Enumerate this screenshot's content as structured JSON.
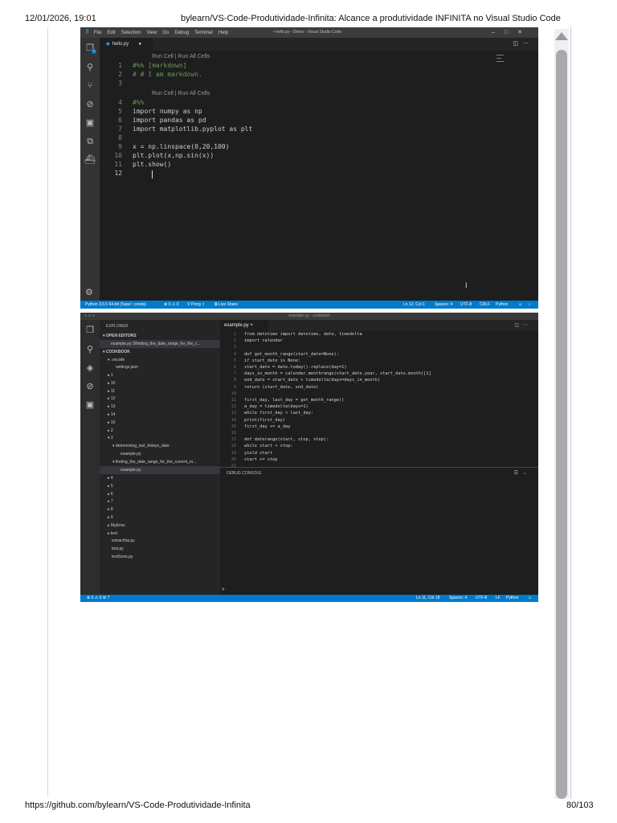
{
  "page": {
    "timestamp": "12/01/2026, 19:01",
    "title": "bylearn/VS-Code-Produtividade-Infinita: Alcance a produtividade INFINITA no Visual Studio Code",
    "footer_url": "https://github.com/bylearn/VS-Code-Produtividade-Infinita",
    "page_number": "80/103"
  },
  "window1": {
    "menu": [
      "File",
      "Edit",
      "Selection",
      "View",
      "Go",
      "Debug",
      "Terminal",
      "Help"
    ],
    "title": "• hello.py - Demo - Visual Studio Code",
    "tab_label": "hello.py",
    "codelens": [
      "Run Cell | Run All Cells",
      "Run Cell | Run All Cells"
    ],
    "lines": [
      {
        "n": "1",
        "code": "#%% [markdown]"
      },
      {
        "n": "2",
        "code": "# # I am markdown."
      },
      {
        "n": "3",
        "code": ""
      },
      {
        "n": "4",
        "code": "#%%"
      },
      {
        "n": "5",
        "code": "import numpy as np"
      },
      {
        "n": "6",
        "code": "import pandas as pd"
      },
      {
        "n": "7",
        "code": "import matplotlib.pyplot as plt"
      },
      {
        "n": "8",
        "code": ""
      },
      {
        "n": "9",
        "code": "x = np.linspace(0,20,100)"
      },
      {
        "n": "10",
        "code": "plt.plot(x,np.sin(x))"
      },
      {
        "n": "11",
        "code": "plt.show()"
      },
      {
        "n": "12",
        "code": ""
      }
    ],
    "status": {
      "python": "Python 3.6.5 64-bit ('base': conda)",
      "problems": "⊗ 0 ⚠ 0",
      "pong": "⚲ Pong ⇧",
      "liveshare": "⧉ Live Share",
      "position": "Ln 12, Col 1",
      "spaces": "Spaces: 4",
      "encoding": "UTF-8",
      "eol": "CRLF",
      "language": "Python"
    }
  },
  "window2": {
    "title": "example.py - cookbook",
    "explorer_label": "EXPLORER",
    "open_editors_label": "▾ OPEN EDITORS",
    "open_editor_item": "example.py 3\\finding_the_date_range_for_the_c...",
    "cookbook_label": "▾ COOKBOOK",
    "tree": [
      "▾ .vscode",
      "settings.json",
      "▸ 1",
      "▸ 10",
      "▸ 11",
      "▸ 12",
      "▸ 13",
      "▸ 14",
      "▸ 15",
      "▸ 2",
      "▾ 3",
      "▾ determining_last_fridays_date",
      "example.py",
      "▾ finding_the_date_range_for_the_current_m...",
      "example.py",
      "▸ 4",
      "▸ 5",
      "▸ 6",
      "▸ 7",
      "▸ 8",
      "▸ 9",
      "▸ MyEnvs",
      "▸ test",
      "extractVar.py",
      "test.py",
      "testSorts.py"
    ],
    "tab_label": "example.py ×",
    "code": [
      {
        "n": "1",
        "t": "from datetime import datetime, date, timedelta"
      },
      {
        "n": "2",
        "t": "import calendar"
      },
      {
        "n": "3",
        "t": ""
      },
      {
        "n": "4",
        "t": "def get_month_range(start_date=None):"
      },
      {
        "n": "5",
        "t": "    if start_date is None:"
      },
      {
        "n": "6",
        "t": "        start_date = date.today().replace(day=1)"
      },
      {
        "n": "7",
        "t": "    days_in_month = calendar.monthrange(start_date.year, start_date.month)[1]"
      },
      {
        "n": "8",
        "t": "    end_date = start_date + timedelta(days=days_in_month)"
      },
      {
        "n": "9",
        "t": "    return (start_date, end_date)"
      },
      {
        "n": "10",
        "t": ""
      },
      {
        "n": "11",
        "t": "first_day, last_day = get_month_range()"
      },
      {
        "n": "12",
        "t": "a_day = timedelta(days=1)"
      },
      {
        "n": "13",
        "t": "while first_day < last_day:"
      },
      {
        "n": "14",
        "t": "    print(first_day)"
      },
      {
        "n": "15",
        "t": "    first_day += a_day"
      },
      {
        "n": "16",
        "t": ""
      },
      {
        "n": "17",
        "t": "def daterange(start, stop, step):"
      },
      {
        "n": "18",
        "t": "    while start < stop:"
      },
      {
        "n": "19",
        "t": "        yield start"
      },
      {
        "n": "20",
        "t": "        start += step"
      },
      {
        "n": "21",
        "t": ""
      }
    ],
    "debug_console_label": "DEBUG CONSOLE",
    "prompt": ">",
    "status": {
      "left": "⊗ 0 ⚠ 0 ⚙ 7",
      "position": "Ln 11, Col 18",
      "spaces": "Spaces: 4",
      "encoding": "UTF-8",
      "eol": "LF",
      "language": "Python"
    }
  }
}
